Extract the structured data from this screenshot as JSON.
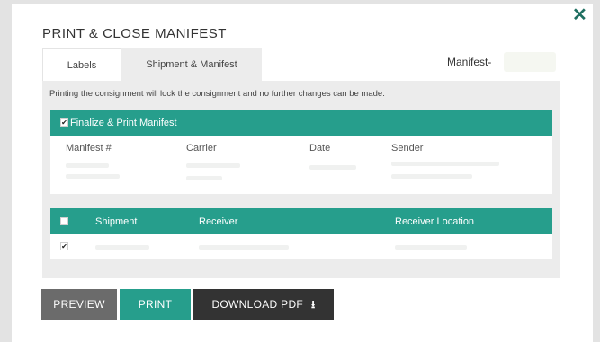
{
  "modal": {
    "title": "PRINT & CLOSE MANIFEST",
    "close_icon": "close-icon"
  },
  "tabs": [
    {
      "label": "Labels"
    },
    {
      "label": "Shipment & Manifest",
      "active": true
    }
  ],
  "manifest_header": "Manifest-",
  "notice": "Printing the consignment will lock the consignment and no further changes can be made.",
  "finalize": {
    "label": "Finalize & Print Manifest",
    "checked": true,
    "columns": [
      "Manifest #",
      "Carrier",
      "Date",
      "Sender"
    ]
  },
  "shipments": {
    "columns": [
      "Shipment",
      "Receiver",
      "Receiver Location"
    ],
    "select_all_checked": false,
    "rows": [
      {
        "checked": true
      }
    ]
  },
  "buttons": {
    "preview": "PREVIEW",
    "print": "PRINT",
    "download": "DOWNLOAD PDF",
    "download_icon": "download-icon"
  },
  "colors": {
    "accent": "#269e8c",
    "close": "#1f6f61",
    "preview_bg": "#6b6b6b",
    "download_bg": "#333333",
    "panel_bg": "#ececec"
  }
}
